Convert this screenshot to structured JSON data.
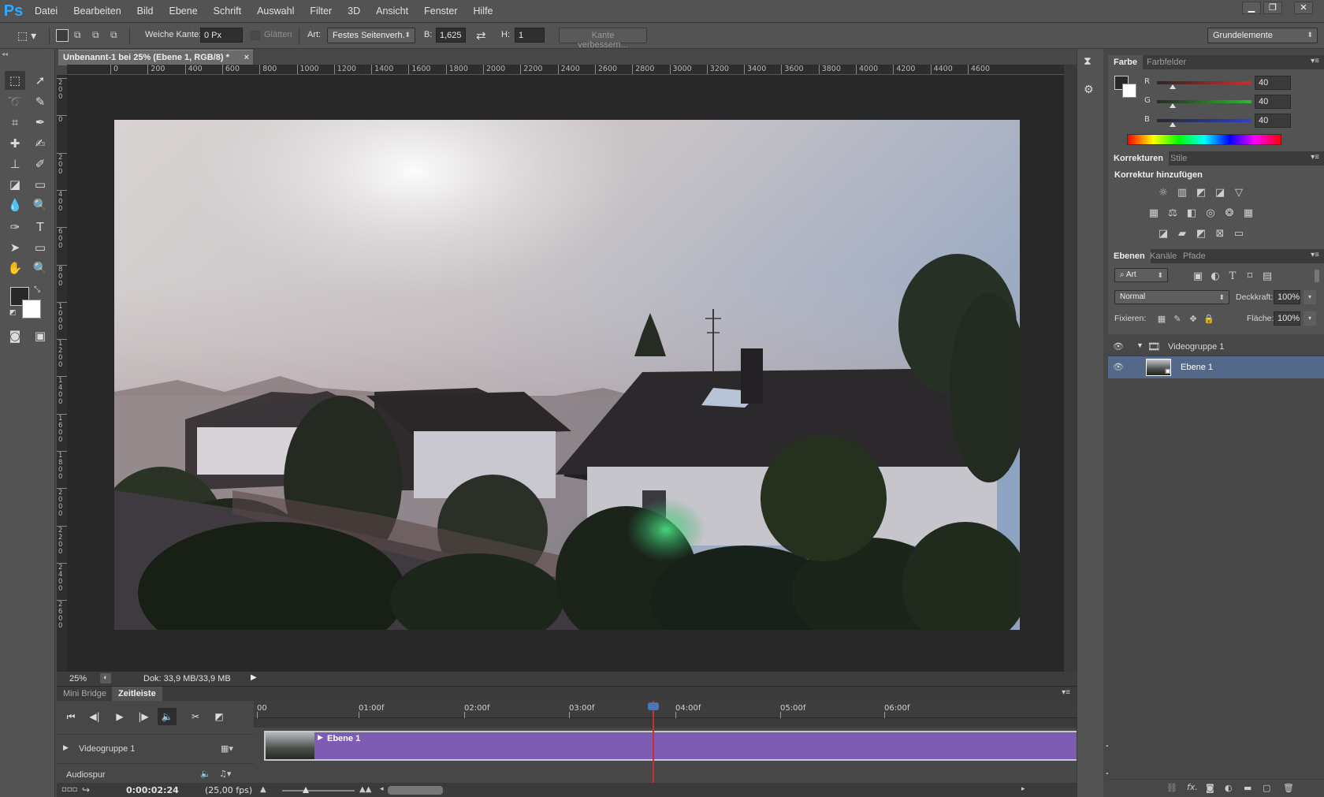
{
  "app": {
    "logo": "Ps"
  },
  "menu": [
    "Datei",
    "Bearbeiten",
    "Bild",
    "Ebene",
    "Schrift",
    "Auswahl",
    "Filter",
    "3D",
    "Ansicht",
    "Fenster",
    "Hilfe"
  ],
  "window_controls": [
    "minimize",
    "restore",
    "close"
  ],
  "options": {
    "soft_edge_label": "Weiche Kante:",
    "soft_edge_value": "0 Px",
    "smooth_label": "Glätten",
    "style_label": "Art:",
    "style_value": "Festes Seitenverh.",
    "width_label": "B:",
    "width_value": "1,625",
    "height_label": "H:",
    "height_value": "1",
    "refine_edge": "Kante verbessern...",
    "workspace": "Grundelemente"
  },
  "document": {
    "tab_title": "Unbenannt-1 bei 25% (Ebene 1, RGB/8) *",
    "ruler_h": [
      "0",
      "200",
      "400",
      "600",
      "800",
      "1000",
      "1200",
      "1400",
      "1600",
      "1800",
      "2000",
      "2200",
      "2400",
      "2600",
      "2800",
      "3000",
      "3200",
      "3400",
      "3600",
      "3800",
      "4000",
      "4200",
      "4400",
      "4600"
    ],
    "ruler_h_left": "0",
    "ruler_v": [
      "200",
      "0",
      "2 0 0",
      "4 0 0",
      "6 0 0",
      "8 0 0",
      "1 0 0 0",
      "1 2 0 0",
      "1 4 0 0",
      "1 6 0 0",
      "1 8 0 0",
      "2 0 0 0",
      "2 2 0 0",
      "2 4 0 0",
      "2 6 0 0"
    ],
    "zoom": "25%",
    "doc_info": "Dok: 33,9 MB/33,9 MB"
  },
  "timeline": {
    "tabs": [
      "Mini Bridge",
      "Zeitleiste"
    ],
    "active_tab": "Zeitleiste",
    "ruler": [
      "00",
      "01:00f",
      "02:00f",
      "03:00f",
      "04:00f",
      "05:00f",
      "06:00f"
    ],
    "group_label": "Videogruppe 1",
    "clip_label": "Ebene 1",
    "audio_label": "Audiospur",
    "timecode": "0:00:02:24",
    "fps": "(25,00 fps)"
  },
  "color_panel": {
    "tabs": [
      "Farbe",
      "Farbfelder"
    ],
    "channels": [
      {
        "label": "R",
        "value": "40",
        "color": "#d22b2b"
      },
      {
        "label": "G",
        "value": "40",
        "color": "#2bbb2b"
      },
      {
        "label": "B",
        "value": "40",
        "color": "#2b3fd2"
      }
    ]
  },
  "adjustments_panel": {
    "tabs": [
      "Korrekturen",
      "Stile"
    ],
    "heading": "Korrektur hinzufügen",
    "row1": [
      "brightness-icon",
      "levels-icon",
      "curves-icon",
      "exposure-icon",
      "vibrance-icon"
    ],
    "row2": [
      "hue-saturation-icon",
      "color-balance-icon",
      "black-white-icon",
      "photo-filter-icon",
      "channel-mixer-icon",
      "color-lookup-icon"
    ],
    "row3": [
      "invert-icon",
      "posterize-icon",
      "threshold-icon",
      "selective-color-icon",
      "gradient-map-icon"
    ]
  },
  "layers_panel": {
    "tabs": [
      "Ebenen",
      "Kanäle",
      "Pfade"
    ],
    "filter_label": "Art",
    "blend_mode": "Normal",
    "opacity_label": "Deckkraft:",
    "opacity_value": "100%",
    "lock_label": "Fixieren:",
    "fill_label": "Fläche:",
    "fill_value": "100%",
    "layers": [
      {
        "name": "Videogruppe 1",
        "type": "group"
      },
      {
        "name": "Ebene 1",
        "type": "layer",
        "selected": true
      }
    ]
  }
}
